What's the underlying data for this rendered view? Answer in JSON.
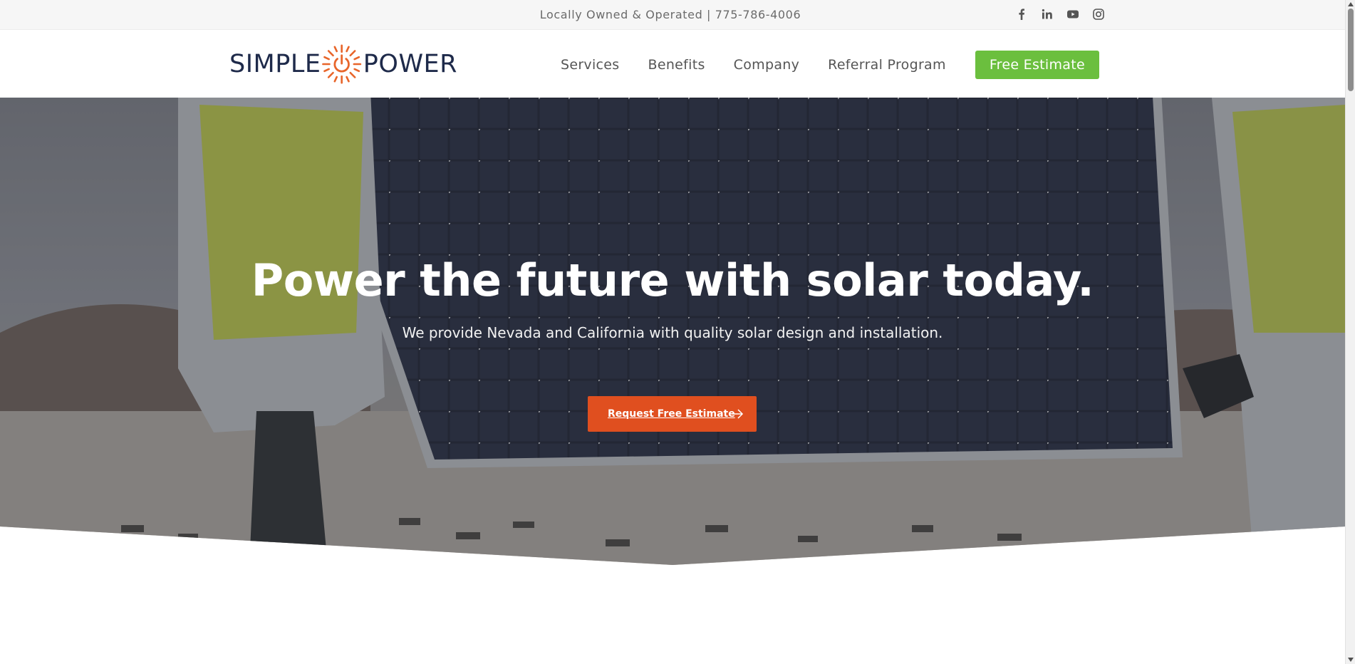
{
  "topbar": {
    "tagline": "Locally Owned & Operated | 775-786-4006",
    "social": [
      "facebook-icon",
      "linkedin-icon",
      "youtube-icon",
      "instagram-icon"
    ]
  },
  "header": {
    "logo": {
      "left_word": "SIMPLE",
      "right_word": "POWER"
    },
    "nav": {
      "services": "Services",
      "benefits": "Benefits",
      "company": "Company",
      "referral": "Referral Program",
      "cta": "Free Estimate"
    }
  },
  "hero": {
    "title": "Power the future with solar today.",
    "subtitle": "We provide Nevada and California with quality solar design and installation.",
    "cta_label": "Request Free Estimate"
  },
  "colors": {
    "brand_navy": "#1e2a4a",
    "brand_orange": "#e8652a",
    "cta_green": "#6bbf3e",
    "cta_orange": "#e04f1f"
  }
}
